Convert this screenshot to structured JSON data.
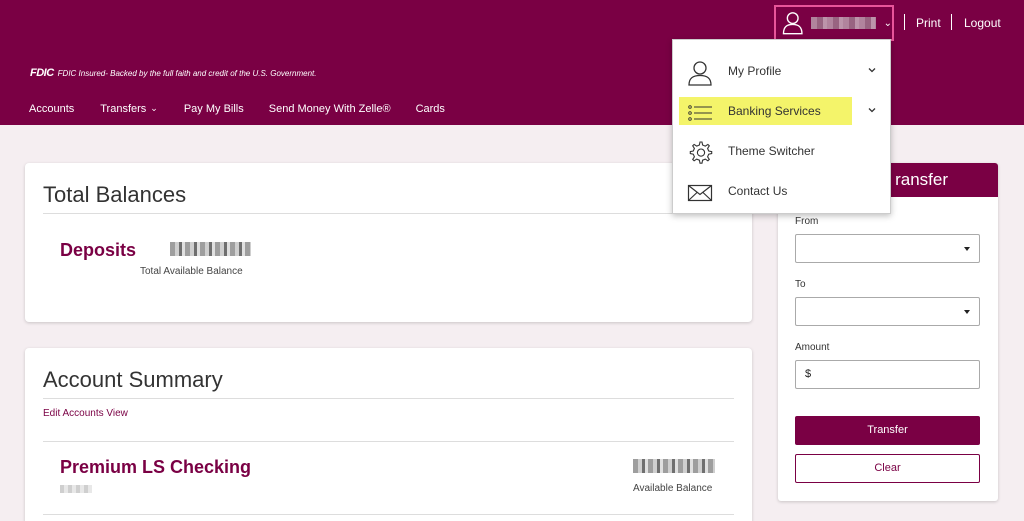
{
  "header": {
    "print_label": "Print",
    "logout_label": "Logout",
    "fdic_logo": "FDIC",
    "fdic_text": "FDIC Insured- Backed by the full faith and credit of the U.S. Government.",
    "nav": [
      "Accounts",
      "Transfers",
      "Pay My Bills",
      "Send Money With Zelle®",
      "Cards"
    ]
  },
  "user_menu": {
    "items": [
      {
        "label": "My Profile",
        "icon": "user-icon",
        "has_chevron": true
      },
      {
        "label": "Banking Services",
        "icon": "list-icon",
        "has_chevron": true,
        "highlighted": true
      },
      {
        "label": "Theme Switcher",
        "icon": "gear-icon",
        "has_chevron": false
      },
      {
        "label": "Contact Us",
        "icon": "envelope-icon",
        "has_chevron": false
      }
    ]
  },
  "total_balances": {
    "title": "Total Balances",
    "deposits_label": "Deposits",
    "balance_caption": "Total Available Balance"
  },
  "account_summary": {
    "title": "Account Summary",
    "edit_link": "Edit Accounts View",
    "account_name": "Premium LS Checking",
    "balance_caption": "Available Balance"
  },
  "quick_transfer": {
    "title_visible": "ransfer",
    "from_label": "From",
    "to_label": "To",
    "amount_label": "Amount",
    "amount_prefix": "$",
    "transfer_button": "Transfer",
    "clear_button": "Clear"
  },
  "colors": {
    "brand": "#7a0044",
    "highlight": "#f4f46a"
  }
}
